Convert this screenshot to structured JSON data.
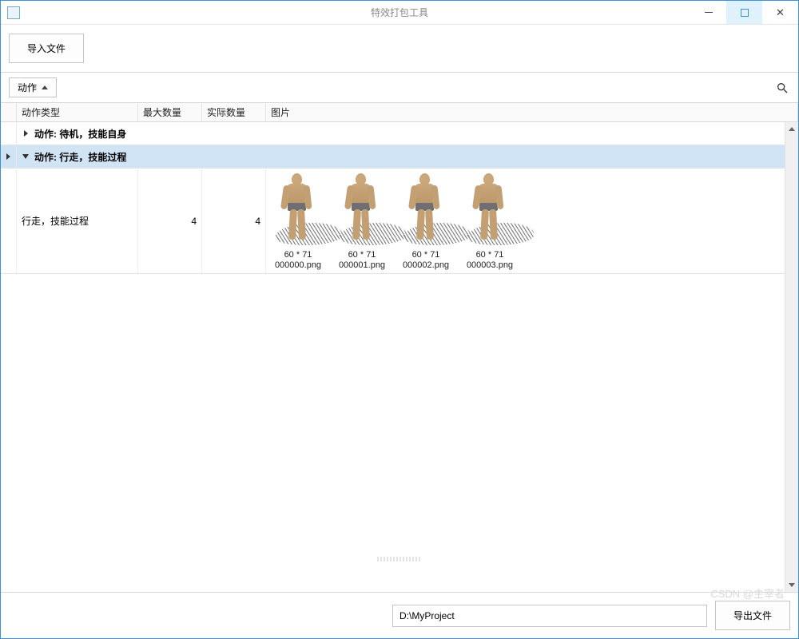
{
  "window": {
    "title": "特效打包工具"
  },
  "toolbar": {
    "import_label": "导入文件"
  },
  "filter": {
    "dropdown_label": "动作"
  },
  "table": {
    "headers": {
      "type": "动作类型",
      "max": "最大数量",
      "actual": "实际数量",
      "image": "图片"
    },
    "groups": [
      {
        "label": "动作: 待机，技能自身",
        "expanded": false
      },
      {
        "label": "动作: 行走，技能过程",
        "expanded": true
      }
    ],
    "row": {
      "type": "行走，技能过程",
      "max": "4",
      "actual": "4",
      "thumbs": [
        {
          "dim": "60 * 71",
          "file": "000000.png"
        },
        {
          "dim": "60 * 71",
          "file": "000001.png"
        },
        {
          "dim": "60 * 71",
          "file": "000002.png"
        },
        {
          "dim": "60 * 71",
          "file": "000003.png"
        }
      ]
    }
  },
  "footer": {
    "path": "D:\\MyProject",
    "export_label": "导出文件"
  },
  "watermark": "CSDN @主宰者"
}
